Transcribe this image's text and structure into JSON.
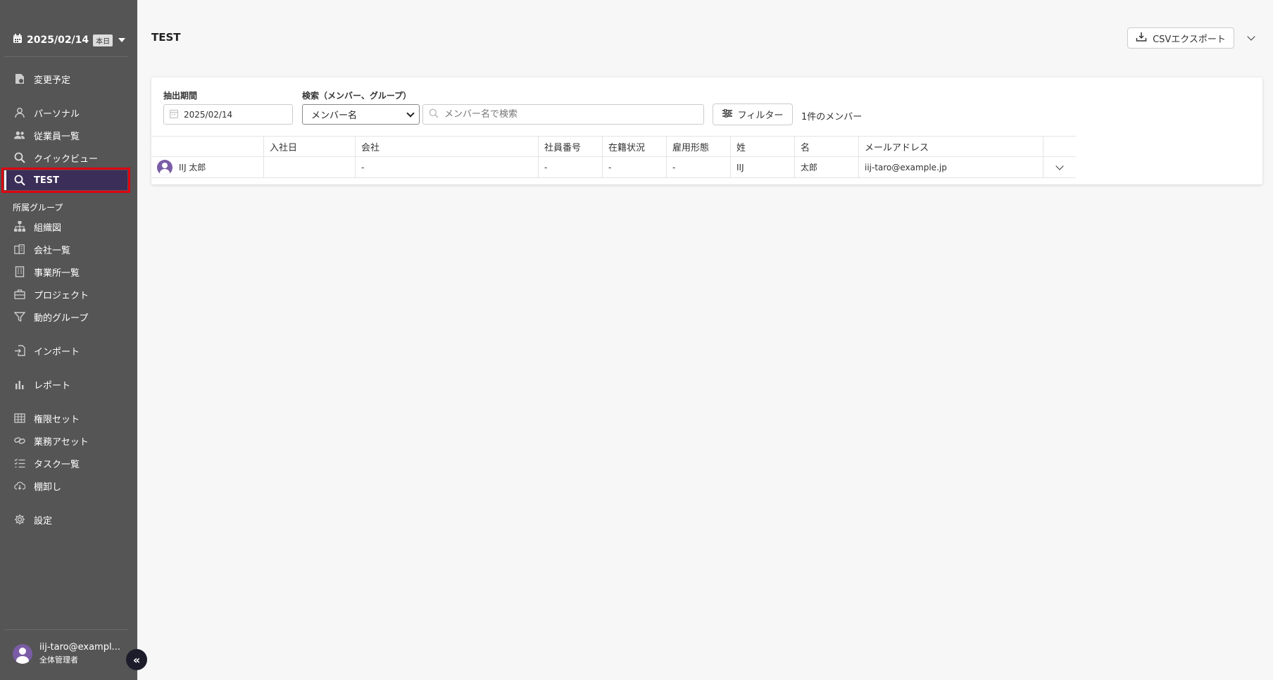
{
  "sidebar": {
    "date": "2025/02/14",
    "today_badge": "本日",
    "items": [
      {
        "label": "変更予定",
        "icon": "document-clock-icon"
      },
      {
        "label": "パーソナル",
        "icon": "person-icon"
      },
      {
        "label": "従業員一覧",
        "icon": "people-icon"
      },
      {
        "label": "クイックビュー",
        "icon": "search-icon"
      },
      {
        "label": "TEST",
        "icon": "search-icon"
      },
      {
        "label": "組織図",
        "icon": "org-chart-icon"
      },
      {
        "label": "会社一覧",
        "icon": "company-icon"
      },
      {
        "label": "事業所一覧",
        "icon": "building-icon"
      },
      {
        "label": "プロジェクト",
        "icon": "briefcase-icon"
      },
      {
        "label": "動的グループ",
        "icon": "filter-icon"
      },
      {
        "label": "インポート",
        "icon": "import-icon"
      },
      {
        "label": "レポート",
        "icon": "bar-chart-icon"
      },
      {
        "label": "権限セット",
        "icon": "grid-icon"
      },
      {
        "label": "業務アセット",
        "icon": "link-icon"
      },
      {
        "label": "タスク一覧",
        "icon": "task-list-icon"
      },
      {
        "label": "棚卸し",
        "icon": "cloud-download-icon"
      },
      {
        "label": "設定",
        "icon": "gear-icon"
      }
    ],
    "section_label": "所属グループ",
    "user": {
      "email": "iij-taro@exampl...",
      "role": "全体管理者"
    },
    "collapse_icon": "«"
  },
  "header": {
    "title": "TEST",
    "csv_button": "CSVエクスポート"
  },
  "filters": {
    "period_label": "抽出期間",
    "period_value": "2025/02/14",
    "search_label": "検索（メンバー、グループ）",
    "search_type": "メンバー名",
    "search_placeholder": "メンバー名で検索",
    "filter_button": "フィルター",
    "member_count": "1件のメンバー"
  },
  "table": {
    "headers": [
      "",
      "入社日",
      "会社",
      "社員番号",
      "在籍状況",
      "雇用形態",
      "姓",
      "名",
      "メールアドレス",
      ""
    ],
    "rows": [
      {
        "name": "IIJ 太郎",
        "join_date": "",
        "company": "-",
        "employee_no": "-",
        "status": "-",
        "employment": "-",
        "last_name": "IIJ",
        "first_name": "太郎",
        "email": "iij-taro@example.jp"
      }
    ]
  },
  "colors": {
    "sidebar_bg": "#555555",
    "active_bg": "#3b2e58",
    "highlight": "#e00010",
    "avatar": "#7a5ca6"
  }
}
